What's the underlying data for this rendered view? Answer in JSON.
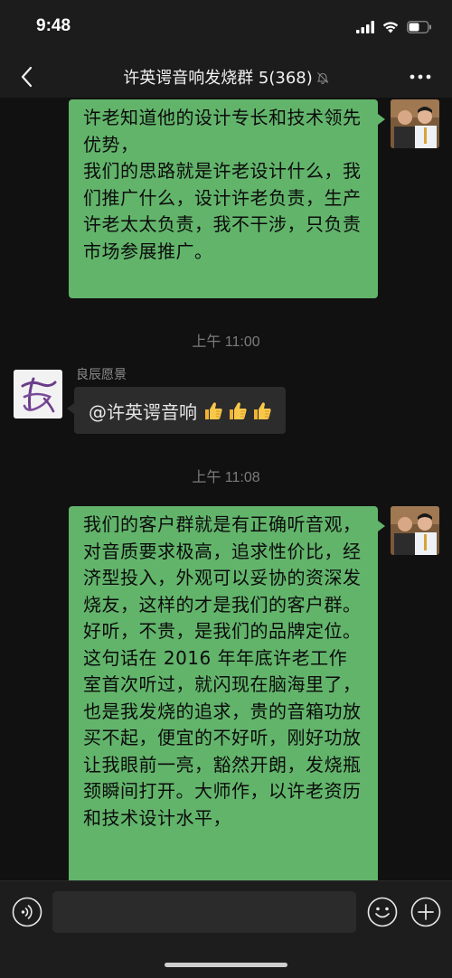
{
  "status_bar": {
    "time": "9:48",
    "icons": [
      "cellular-signal-icon",
      "wifi-icon",
      "battery-icon"
    ]
  },
  "nav": {
    "title": "许英谔音响发烧群 5(368)",
    "back_icon": "chevron-left-icon",
    "mute_icon": "bell-muted-icon",
    "more_icon": "more-dots-icon"
  },
  "messages": [
    {
      "type": "outgoing",
      "text": "许老知道他的设计专长和技术领先优势，\n我们的思路就是许老设计什么，我们推广什么，设计许老负责，生产许老太太负责，我不干涉，只负责市场参展推广。"
    },
    {
      "type": "timestamp",
      "text": "上午 11:00"
    },
    {
      "type": "incoming",
      "sender": "良辰愿景",
      "text": "@许英谔音响",
      "emoji": [
        "thumbs-up-icon",
        "thumbs-up-icon",
        "thumbs-up-icon"
      ]
    },
    {
      "type": "timestamp",
      "text": "上午 11:08"
    },
    {
      "type": "outgoing",
      "text": "我们的客户群就是有正确听音观，对音质要求极高，追求性价比，经济型投入，外观可以妥协的资深发烧友，这样的才是我们的客户群。好听，不贵，是我们的品牌定位。这句话在 2016 年年底许老工作室首次听过，就闪现在脑海里了，也是我发烧的追求，贵的音箱功放买不起，便宜的不好听，刚好功放让我眼前一亮，豁然开朗，发烧瓶颈瞬间打开。大师作，以许老资历和技术设计水平，"
    }
  ],
  "input_bar": {
    "voice_icon": "voice-input-icon",
    "emoji_icon": "emoji-smile-icon",
    "plus_icon": "plus-circle-icon",
    "text_value": ""
  },
  "colors": {
    "background": "#111111",
    "bar_background": "#1c1c1c",
    "outgoing_bubble": "#62b46b",
    "incoming_bubble": "#2c2c2c",
    "timestamp_text": "#7b7b7b"
  }
}
